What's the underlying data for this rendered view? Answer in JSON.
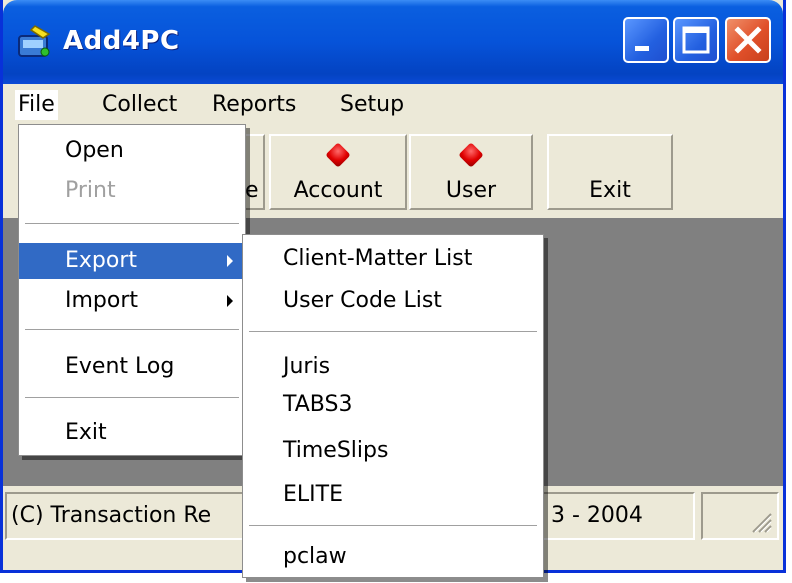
{
  "window": {
    "title": "Add4PC",
    "title_color": "#0653d9",
    "close_color": "#e0502a"
  },
  "menubar": {
    "items": [
      {
        "label": "File"
      },
      {
        "label": "Collect"
      },
      {
        "label": "Reports"
      },
      {
        "label": "Setup"
      }
    ]
  },
  "toolbar": {
    "partial_label": "e",
    "account_label": "Account",
    "user_label": "User",
    "exit_label": "Exit",
    "indicator_color": "#e00000"
  },
  "statusbar": {
    "left_text": "(C) Transaction Re",
    "right_text": "3 - 2004"
  },
  "file_menu": {
    "open": "Open",
    "print": "Print",
    "export": "Export",
    "import": "Import",
    "event_log": "Event Log",
    "exit": "Exit",
    "highlight_color": "#316ac5"
  },
  "export_submenu": {
    "items": [
      "Client-Matter List",
      "User Code List",
      "Juris",
      "TABS3",
      "TimeSlips",
      "ELITE",
      "pclaw"
    ]
  },
  "icons": {
    "app": "add4pc-app-icon",
    "minimize": "minimize-icon",
    "maximize": "maximize-icon",
    "close": "close-icon",
    "submenu_arrow": "submenu-arrow-icon",
    "indicator": "red-indicator-icon",
    "grip": "resize-grip-icon"
  }
}
